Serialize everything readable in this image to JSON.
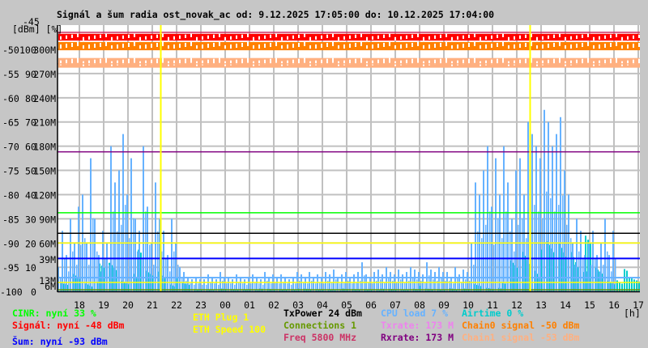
{
  "title": "Signál a šum radia ost_novak_ac od: 9.12.2025 17:05:00 do: 10.12.2025 17:04:00",
  "colors": {
    "grid": "#c0c0c0",
    "signal": "#ff0000",
    "noise": "#0000ff",
    "cinr": "#00ff00",
    "cpu": "#66b2ff",
    "airtime": "#00cccc",
    "chain0": "#ff8000",
    "chain1": "#ffb080",
    "txrate": "#ee82ee",
    "rxrate": "#800080",
    "txpower": "#000000",
    "eth": "#ffff00",
    "connections": "#669900",
    "freq": "#cc3366"
  },
  "chart_data": {
    "type": "line",
    "title": "Signál a šum radia ost_novak_ac od: 9.12.2025 17:05:00 do: 10.12.2025 17:04:00",
    "y_unit_label": "[dBm] [%]",
    "x_unit_label": "[h]",
    "y_ticks": [
      {
        "dbm": "-45",
        "pct": "",
        "mbps": ""
      },
      {
        "dbm": "-50",
        "pct": "100",
        "mbps": "300M"
      },
      {
        "dbm": "-55",
        "pct": "90",
        "mbps": "270M"
      },
      {
        "dbm": "-60",
        "pct": "80",
        "mbps": "240M"
      },
      {
        "dbm": "-65",
        "pct": "70",
        "mbps": "210M"
      },
      {
        "dbm": "-70",
        "pct": "60",
        "mbps": "180M"
      },
      {
        "dbm": "-75",
        "pct": "50",
        "mbps": "150M"
      },
      {
        "dbm": "-80",
        "pct": "40",
        "mbps": "120M"
      },
      {
        "dbm": "-85",
        "pct": "30",
        "mbps": "90M"
      },
      {
        "dbm": "-90",
        "pct": "20",
        "mbps": "60M"
      },
      {
        "dbm": "-95",
        "pct": "10",
        "mbps": ""
      },
      {
        "dbm": "-100",
        "pct": "0",
        "mbps": ""
      }
    ],
    "ylim_dbm": [
      -100,
      -45
    ],
    "ylim_pct": [
      0,
      100
    ],
    "ylim_mbps": [
      0,
      300
    ],
    "x_ticks": [
      "18",
      "19",
      "20",
      "21",
      "22",
      "23",
      "00",
      "01",
      "02",
      "03",
      "04",
      "05",
      "06",
      "07",
      "08",
      "09",
      "10",
      "11",
      "12",
      "13",
      "14",
      "15",
      "16",
      "17"
    ],
    "right_markers": [
      {
        "label": "39M",
        "mbps": 39,
        "color": "#ee82ee"
      },
      {
        "label": "13M",
        "mbps": 13,
        "color": "#ee82ee"
      },
      {
        "label": "6M",
        "mbps": 6,
        "color": "#800080"
      }
    ],
    "bands_dbm": [
      {
        "name": "Signál",
        "from": -46.8,
        "to": -48.2,
        "color": "#ff0000"
      },
      {
        "name": "Chain0 signal",
        "from": -48.5,
        "to": -50.2,
        "color": "#ff8000"
      },
      {
        "name": "Chain1 signal",
        "from": -51.8,
        "to": -53.8,
        "color": "#ffb080"
      }
    ],
    "level_lines": [
      {
        "name": "signal-max",
        "dbm": -46.5,
        "color": "#cc3366"
      },
      {
        "name": "chain0-line",
        "dbm": -50,
        "color": "#ff8000"
      },
      {
        "name": "chain1-line",
        "dbm": -53,
        "color": "#ffb080"
      },
      {
        "name": "rxrate",
        "mbps": 173,
        "color": "#800080"
      },
      {
        "name": "txpower",
        "mbps": 72,
        "color": "#000000"
      },
      {
        "name": "eth-speed",
        "mbps": 60,
        "color": "#ffff00"
      },
      {
        "name": "eth-plug",
        "mbps": 11,
        "color": "#ffff00"
      },
      {
        "name": "connections",
        "mbps": 2,
        "color": "#669900"
      },
      {
        "name": "cinr",
        "pct": 32.5,
        "color": "#00ff00"
      },
      {
        "name": "noise",
        "dbm": -93.2,
        "color": "#0000ff"
      }
    ],
    "eth_events_hour": [
      21.35,
      12.55
    ],
    "cpu_load_pct_10min": [
      10,
      25,
      15,
      30,
      20,
      35,
      40,
      20,
      55,
      30,
      15,
      25,
      20,
      60,
      45,
      50,
      65,
      40,
      55,
      30,
      25,
      60,
      35,
      20,
      45,
      30,
      25,
      15,
      30,
      20,
      10,
      8,
      6,
      5,
      6,
      5,
      5,
      7,
      6,
      5,
      8,
      6,
      6,
      5,
      7,
      6,
      5,
      6,
      7,
      6,
      5,
      8,
      6,
      7,
      6,
      7,
      6,
      5,
      6,
      8,
      7,
      6,
      8,
      6,
      7,
      6,
      8,
      7,
      9,
      6,
      7,
      8,
      6,
      7,
      8,
      12,
      7,
      6,
      8,
      9,
      7,
      10,
      8,
      7,
      9,
      7,
      8,
      10,
      9,
      8,
      7,
      12,
      9,
      8,
      10,
      8,
      8,
      6,
      10,
      7,
      9,
      8,
      20,
      45,
      40,
      50,
      60,
      35,
      55,
      40,
      60,
      45,
      30,
      50,
      55,
      40,
      70,
      65,
      60,
      55,
      75,
      70,
      60,
      65,
      72,
      50,
      40,
      20,
      30,
      25,
      15,
      20,
      25,
      15,
      20,
      30,
      15,
      25
    ],
    "airtime_pct_30min": [
      3,
      8,
      5,
      10,
      12,
      6,
      15,
      8,
      10,
      5,
      3,
      1,
      1,
      1,
      1,
      1,
      1,
      1,
      1,
      1,
      1,
      1,
      1,
      1,
      1,
      1,
      1,
      1,
      1,
      2,
      1,
      1,
      2,
      1,
      3,
      2,
      3,
      12,
      20,
      15,
      18,
      22,
      25,
      20,
      10,
      6,
      8,
      5
    ],
    "series": [
      {
        "name": "CINR",
        "current": "33 %"
      },
      {
        "name": "Signál",
        "current": "-48 dBm"
      },
      {
        "name": "Šum",
        "current": "-93 dBm"
      },
      {
        "name": "CPU load",
        "current": "7 %"
      },
      {
        "name": "Airtime",
        "current": "0 %"
      }
    ]
  },
  "legend": [
    {
      "text": "CINR: nyní 33 %",
      "color": "#00ff00",
      "col": 0,
      "row": 0
    },
    {
      "text": "Signál: nyní -48 dBm",
      "color": "#ff0000",
      "col": 0,
      "row": 1
    },
    {
      "text": "Šum: nyní -93 dBm",
      "color": "#0000ff",
      "col": 0,
      "row": 2
    },
    {
      "text": "ETH Plug 1",
      "color": "#ffff00",
      "col": 1,
      "row": 0
    },
    {
      "text": "ETH Speed 100",
      "color": "#ffff00",
      "col": 1,
      "row": 1
    },
    {
      "text": "TxPower 24 dBm",
      "color": "#000000",
      "col": 2,
      "row": 0
    },
    {
      "text": "Connections 1",
      "color": "#669900",
      "col": 2,
      "row": 1
    },
    {
      "text": "Freq 5800 MHz",
      "color": "#cc3366",
      "col": 2,
      "row": 2
    },
    {
      "text": "CPU load 7 %",
      "color": "#66b2ff",
      "col": 3,
      "row": 0
    },
    {
      "text": "Txrate: 173 M",
      "color": "#ee82ee",
      "col": 3,
      "row": 1
    },
    {
      "text": "Rxrate: 173 M",
      "color": "#800080",
      "col": 3,
      "row": 2
    },
    {
      "text": "Airtime 0 %",
      "color": "#00cccc",
      "col": 4,
      "row": 0
    },
    {
      "text": "Chain0 signal -50 dBm",
      "color": "#ff8000",
      "col": 4,
      "row": 1
    },
    {
      "text": "Chain1 signal -53 dBm",
      "color": "#ffb080",
      "col": 4,
      "row": 2
    }
  ]
}
